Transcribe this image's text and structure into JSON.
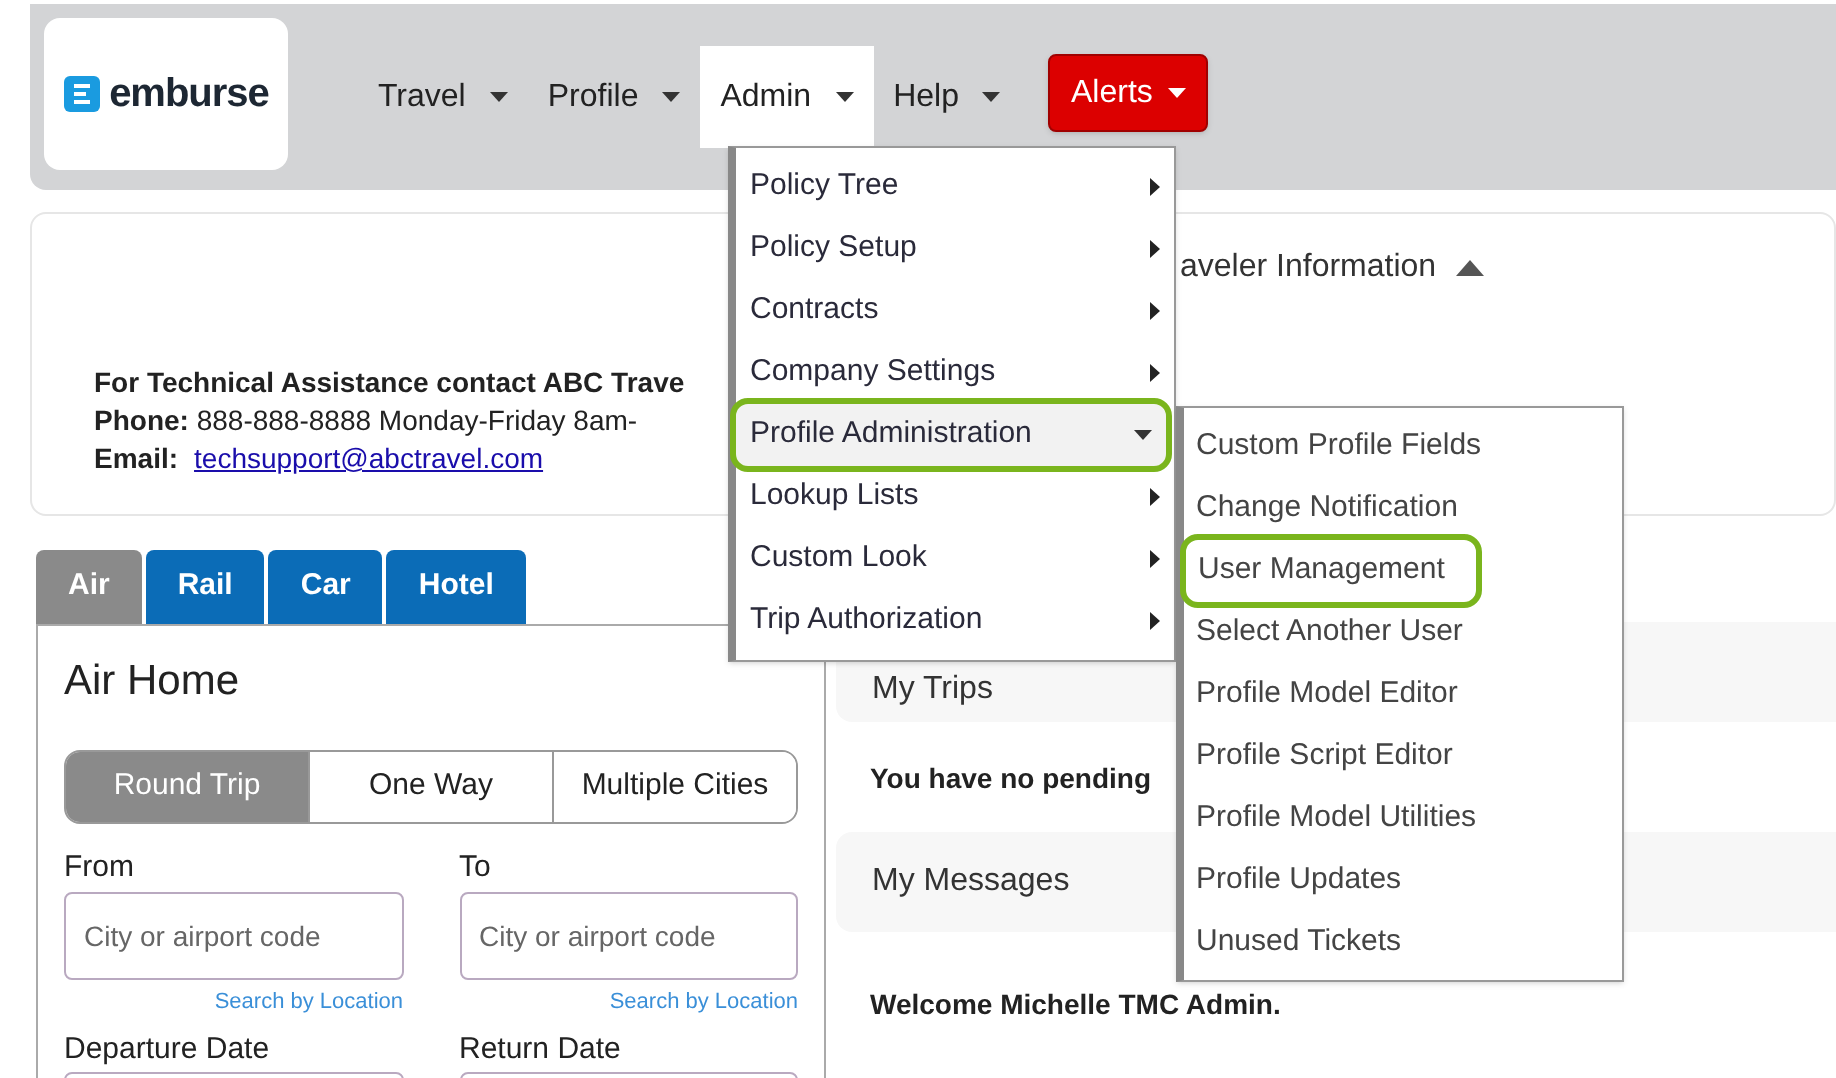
{
  "logo": {
    "text": "emburse"
  },
  "nav": [
    {
      "label": "Travel",
      "kind": "dropdown",
      "open": false
    },
    {
      "label": "Profile",
      "kind": "dropdown",
      "open": false
    },
    {
      "label": "Admin",
      "kind": "dropdown",
      "open": true
    },
    {
      "label": "Help",
      "kind": "dropdown",
      "open": false
    },
    {
      "label": "Alerts",
      "kind": "alert",
      "open": false
    }
  ],
  "contact": {
    "lines": [
      {
        "kind": "text",
        "text": "For Technical Assistance contact ABC Trave"
      },
      {
        "kind": "text",
        "text": "**Phone:**  888-888-8888 Monday-Friday 8am-"
      },
      {
        "kind": "link",
        "label": "Email:",
        "link": "techsupport@abctravel.com"
      }
    ]
  },
  "traveler_info": {
    "label": "aveler Information",
    "expanded": true
  },
  "tabs": [
    {
      "label": "Air",
      "selected": true
    },
    {
      "label": "Rail",
      "selected": false
    },
    {
      "label": "Car",
      "selected": false
    },
    {
      "label": "Hotel",
      "selected": false
    }
  ],
  "air": {
    "title": "Air Home",
    "trip_types": [
      {
        "label": "Round Trip",
        "selected": true
      },
      {
        "label": "One Way",
        "selected": false
      },
      {
        "label": "Multiple Cities",
        "selected": false
      }
    ],
    "places": [
      {
        "label": "From",
        "placeholder": "City or airport code",
        "link": "Search by Location"
      },
      {
        "label": "To",
        "placeholder": "City or airport code",
        "link": "Search by Location"
      }
    ],
    "dates": [
      {
        "label": "Departure Date"
      },
      {
        "label": "Return Date"
      }
    ]
  },
  "sections": [
    {
      "title": "My Trips",
      "body": "You have no pending"
    },
    {
      "title": "My Messages",
      "body": "Welcome Michelle TMC Admin."
    }
  ],
  "admin_menu": {
    "items": [
      {
        "label": "Policy Tree",
        "selected": false,
        "expanded": false
      },
      {
        "label": "Policy Setup",
        "selected": false,
        "expanded": false
      },
      {
        "label": "Contracts",
        "selected": false,
        "expanded": false
      },
      {
        "label": "Company Settings",
        "selected": false,
        "expanded": false
      },
      {
        "label": "Profile Administration",
        "selected": true,
        "expanded": true
      },
      {
        "label": "Lookup Lists",
        "selected": false,
        "expanded": false
      },
      {
        "label": "Custom Look",
        "selected": false,
        "expanded": false
      },
      {
        "label": "Trip Authorization",
        "selected": false,
        "expanded": false
      }
    ],
    "submenu": [
      {
        "label": "Custom Profile Fields",
        "selected": false
      },
      {
        "label": "Change Notification",
        "selected": false
      },
      {
        "label": "User Management",
        "selected": true
      },
      {
        "label": "Select Another User",
        "selected": false
      },
      {
        "label": "Profile Model Editor",
        "selected": false
      },
      {
        "label": "Profile Script Editor",
        "selected": false
      },
      {
        "label": "Profile Model Utilities",
        "selected": false
      },
      {
        "label": "Profile Updates",
        "selected": false
      },
      {
        "label": "Unused Tickets",
        "selected": false
      }
    ]
  }
}
